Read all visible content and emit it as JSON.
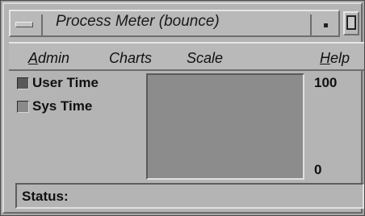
{
  "window": {
    "title": "Process Meter (bounce)"
  },
  "menu": {
    "items": [
      {
        "label": "Admin",
        "mnemonic_index": 0
      },
      {
        "label": "Charts"
      },
      {
        "label": "Scale"
      },
      {
        "label": "Help",
        "mnemonic_index": 0
      }
    ]
  },
  "legend": {
    "user_time": {
      "label": "User Time",
      "color": "#5a5a5a"
    },
    "sys_time": {
      "label": "Sys Time",
      "color": "#8a8a8a"
    }
  },
  "graph": {
    "background": "#8c8c8c"
  },
  "scale": {
    "max_label": "100",
    "min_label": "0"
  },
  "status": {
    "label": "Status:",
    "value": ""
  },
  "colors": {
    "window_bg": "#b4b4b4"
  },
  "icons": {
    "window_menu": "window-menu-icon",
    "minimize": "minimize-icon",
    "maximize": "maximize-icon"
  }
}
